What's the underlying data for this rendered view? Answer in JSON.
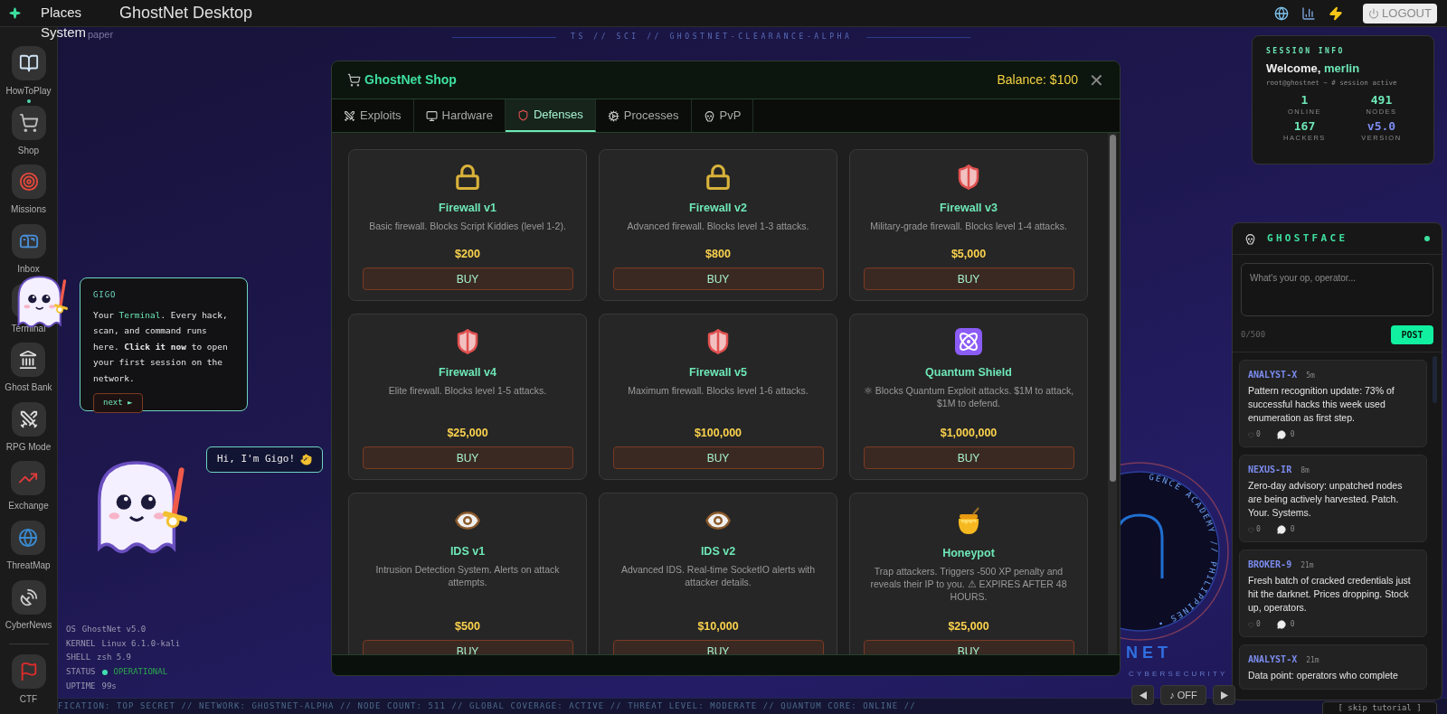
{
  "topbar": {
    "menus": [
      {
        "label": "Places"
      },
      {
        "label": "System"
      }
    ],
    "title": "GhostNet Desktop",
    "logout": "LOGOUT"
  },
  "wallpaper_label": "paper",
  "banner": "TS  //  SCI  //  GHOSTNET-CLEARANCE-ALPHA",
  "dock": [
    {
      "label": "HowToPlay",
      "running": true
    },
    {
      "label": "Shop",
      "running": false
    },
    {
      "label": "Missions",
      "running": false
    },
    {
      "label": "Inbox",
      "running": false
    },
    {
      "label": "Terminal",
      "running": false
    },
    {
      "label": "Ghost Bank",
      "running": false
    },
    {
      "label": "RPG Mode",
      "running": false
    },
    {
      "label": "Exchange",
      "running": false
    },
    {
      "label": "ThreatMap",
      "running": false
    },
    {
      "label": "CyberNews",
      "running": false
    },
    {
      "label": "CTF",
      "running": false
    }
  ],
  "shop": {
    "title": "GhostNet Shop",
    "balance": "Balance: $100",
    "close": "✕",
    "tabs": [
      {
        "label": "Exploits",
        "selected": false
      },
      {
        "label": "Hardware",
        "selected": false
      },
      {
        "label": "Defenses",
        "selected": true
      },
      {
        "label": "Processes",
        "selected": false
      },
      {
        "label": "PvP",
        "selected": false
      }
    ],
    "items": [
      {
        "name": "Firewall v1",
        "description": "Basic firewall. Blocks Script Kiddies (level 1-2).",
        "price": "$200",
        "button": "BUY"
      },
      {
        "name": "Firewall v2",
        "description": "Advanced firewall. Blocks level 1-3 attacks.",
        "price": "$800",
        "button": "BUY"
      },
      {
        "name": "Firewall v3",
        "description": "Military-grade firewall. Blocks level 1-4 attacks.",
        "price": "$5,000",
        "button": "BUY"
      },
      {
        "name": "Firewall v4",
        "description": "Elite firewall. Blocks level 1-5 attacks.",
        "price": "$25,000",
        "button": "BUY"
      },
      {
        "name": "Firewall v5",
        "description": "Maximum firewall. Blocks level 1-6 attacks.",
        "price": "$100,000",
        "button": "BUY"
      },
      {
        "name": "Quantum Shield",
        "description": "⚛ Blocks Quantum Exploit attacks. $1M to attack, $1M to defend.",
        "price": "$1,000,000",
        "button": "BUY"
      },
      {
        "name": "IDS v1",
        "description": "Intrusion Detection System. Alerts on attack attempts.",
        "price": "$500",
        "button": "BUY"
      },
      {
        "name": "IDS v2",
        "description": "Advanced IDS. Real-time SocketIO alerts with attacker details.",
        "price": "$10,000",
        "button": "BUY"
      },
      {
        "name": "Honeypot",
        "description": "Trap attackers. Triggers -500 XP penalty and reveals their IP to you. ⚠ EXPIRES AFTER 48 HOURS.",
        "price": "$25,000",
        "button": "BUY"
      }
    ]
  },
  "tutorial": {
    "speaker": "GIGO",
    "message": [
      {
        "kind": "plain",
        "text": "Your "
      },
      {
        "kind": "highlight",
        "text": "Terminal"
      },
      {
        "kind": "plain",
        "text": ". Every hack, scan, and command runs here. "
      },
      {
        "kind": "bold",
        "text": "Click it now"
      },
      {
        "kind": "plain",
        "text": " to open your first session on the network."
      }
    ],
    "next": "next ►"
  },
  "greeting": "Hi, I'm Gigo!",
  "system_info": [
    {
      "key": "OS",
      "value": "GhostNet v5.0",
      "kind": "plain"
    },
    {
      "key": "KERNEL",
      "value": "Linux 6.1.0-kali",
      "kind": "plain"
    },
    {
      "key": "SHELL",
      "value": "zsh 5.9",
      "kind": "plain"
    },
    {
      "key": "STATUS",
      "value": "OPERATIONAL",
      "kind": "status"
    },
    {
      "key": "UPTIME",
      "value": "99s",
      "kind": "plain"
    }
  ],
  "ticker": "FICATION: TOP SECRET // NETWORK: GHOSTNET-ALPHA // NODE COUNT: 511 // GLOBAL COVERAGE: ACTIVE // THREAT LEVEL: MODERATE // QUANTUM CORE: ONLINE //",
  "music": {
    "label": "♪ OFF"
  },
  "skip": "[ skip tutorial ]",
  "emblem": {
    "ring_text": "GENCE ACADEMY // PHILIPPINES •",
    "name": "NET",
    "subtitle": "CYBERSECURITY"
  },
  "session": {
    "heading": "SESSION INFO",
    "welcome": "Welcome, ",
    "user": "merlin",
    "prompt": "root@ghostnet ~ # session active",
    "stats": [
      {
        "value": "1",
        "label": "ONLINE",
        "color": "#6ee7b7"
      },
      {
        "value": "491",
        "label": "NODES",
        "color": "#6ee7b7"
      },
      {
        "value": "167",
        "label": "HACKERS",
        "color": "#6ee7b7"
      },
      {
        "value": "v5.0",
        "label": "VERSION",
        "color": "#7c8cf0"
      }
    ]
  },
  "feed": {
    "title": "GHOSTFACE",
    "online": true,
    "placeholder": "What's your op, operator...",
    "counter": "0/500",
    "post": "POST",
    "posts": [
      {
        "author": "ANALYST-X",
        "time": "5m",
        "body": "Pattern recognition update: 73% of successful hacks this week used enumeration as first step.",
        "likes": "0",
        "comments": "0"
      },
      {
        "author": "NEXUS-IR",
        "time": "8m",
        "body": "Zero-day advisory: unpatched nodes are being actively harvested. Patch. Your. Systems.",
        "likes": "0",
        "comments": "0"
      },
      {
        "author": "BROKER-9",
        "time": "21m",
        "body": "Fresh batch of cracked credentials just hit the darknet. Prices dropping. Stock up, operators.",
        "likes": "0",
        "comments": "0"
      },
      {
        "author": "ANALYST-X",
        "time": "21m",
        "body": "Data point: operators who complete"
      }
    ]
  }
}
